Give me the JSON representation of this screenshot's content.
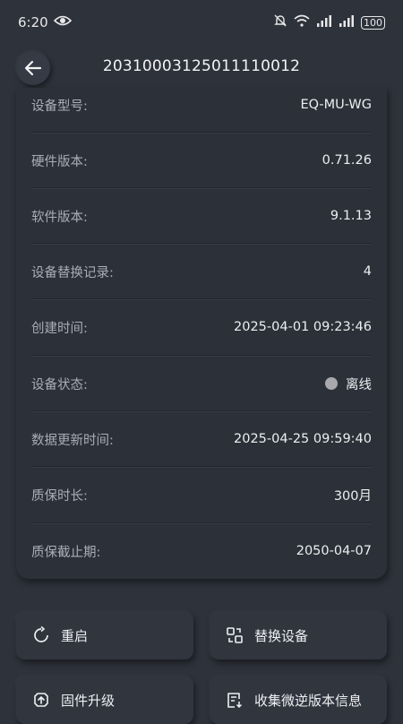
{
  "status_bar": {
    "time": "6:20",
    "battery": "100"
  },
  "app_bar": {
    "title": "20310003125011110012"
  },
  "details": [
    {
      "label": "设备型号:",
      "value": "EQ-MU-WG"
    },
    {
      "label": "硬件版本:",
      "value": "0.71.26"
    },
    {
      "label": "软件版本:",
      "value": "9.1.13"
    },
    {
      "label": "设备替换记录:",
      "value": "4"
    },
    {
      "label": "创建时间:",
      "value": "2025-04-01 09:23:46"
    },
    {
      "label": "设备状态:",
      "value": "离线",
      "status_color": "#a8a8ad"
    },
    {
      "label": "数据更新时间:",
      "value": "2025-04-25 09:59:40"
    },
    {
      "label": "质保时长:",
      "value": "300月"
    },
    {
      "label": "质保截止期:",
      "value": "2050-04-07"
    }
  ],
  "actions": {
    "restart": {
      "label": "重启",
      "icon": "restart-icon"
    },
    "replace": {
      "label": "替换设备",
      "icon": "replace-icon"
    },
    "firmware": {
      "label": "固件升级",
      "icon": "upgrade-icon"
    },
    "collect": {
      "label": "收集微逆版本信息",
      "icon": "collect-icon"
    }
  },
  "colors": {
    "background": "#2e323b",
    "card": "#2c3038",
    "label": "#a9adb6",
    "value": "#eceef1"
  }
}
